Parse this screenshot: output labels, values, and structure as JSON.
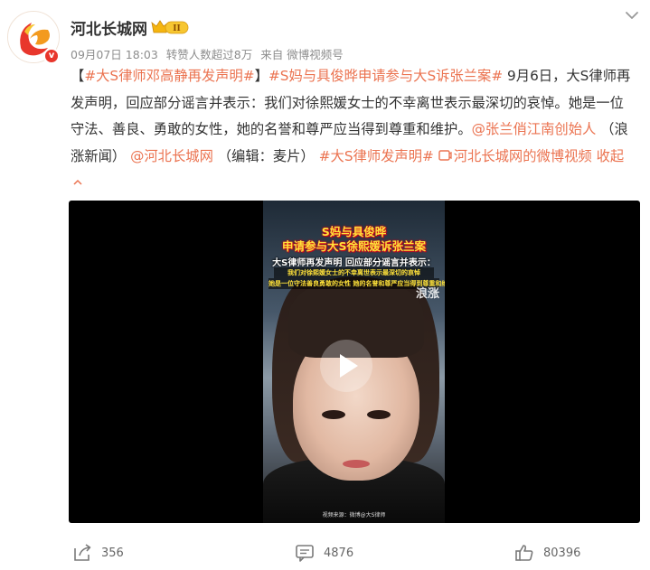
{
  "account": {
    "name": "河北长城网",
    "vip_level": "II",
    "verified_badge": "v",
    "avatar_icon": "hebei-changcheng-logo"
  },
  "meta": {
    "date_time": "09月07日 18:03",
    "reposts": "转赞人数超过8万",
    "source": "来自 微博视频号"
  },
  "content": {
    "bracket_open": "【",
    "hashtag_1": "#大S律师邓高静再发声明#",
    "bracket_close": "】",
    "hashtag_2": "#S妈与具俊晔申请参与大S诉张兰案#",
    "text_1": " 9月6日，大S律师再发声明，回应部分谣言并表示：我们对徐熙媛女士的不幸离世表示最深切的哀悼。她是一位守法、善良、勇敢的女性，她的名誉和尊严应当得到尊重和维护。",
    "mention_1": "@张兰俏江南创始人",
    "text_2": " （浪涨新闻）",
    "mention_2": "@河北长城网",
    "text_3": " （编辑：麦片）",
    "hashtag_3": "#大S律师发声明#",
    "video_link": "河北长城网的微博视频",
    "collapse": "收起"
  },
  "video": {
    "caption_1": "S妈与具俊晔",
    "caption_2": "申请参与大S徐熙媛诉张兰案",
    "caption_3": "大S律师再发声明 回应部分谣言并表示：",
    "caption_4": "我们对徐熙媛女士的不幸离世表示最深切的哀悼",
    "caption_5": "她是一位守法善良勇敢的女性 她的名誉和尊严应当得到尊重和维护",
    "watermark": "浪涨",
    "footer": "视频来源：微博@大S律师",
    "play_icon": "play-icon"
  },
  "actions": {
    "share_count": "356",
    "comment_count": "4876",
    "like_count": "80396"
  },
  "colors": {
    "link": "#eb7350",
    "text": "#333333",
    "meta": "#8d8d8d"
  }
}
